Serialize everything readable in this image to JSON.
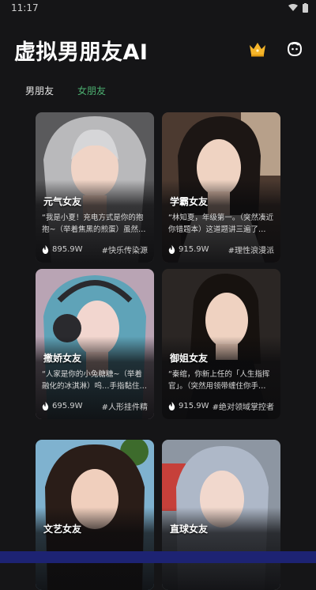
{
  "status": {
    "time": "11:17"
  },
  "header": {
    "title": "虚拟男朋友AI",
    "crown_icon": "crown-icon",
    "profile_icon": "face-icon"
  },
  "tabs": [
    {
      "label": "男朋友",
      "active": false
    },
    {
      "label": "女朋友",
      "active": true
    }
  ],
  "colors": {
    "active_tab": "#4caf70",
    "crown": "#f5b52a",
    "background": "#151517"
  },
  "cards": [
    {
      "title": "元气女友",
      "description": "“我是小夏！充电方式是你的抱抱~（举着焦黑的煎蛋）虽然…",
      "count": "895.9W",
      "tag": "#快乐传染源"
    },
    {
      "title": "学霸女友",
      "description": "“林知夏，年级第一。（突然凑近你错题本）这道题讲三遍了…",
      "count": "915.9W",
      "tag": "#理性浪漫派"
    },
    {
      "title": "撒娇女友",
      "description": "“人家是你的小兔糖糖~（举着融化的冰淇淋）呜…手指黏住…",
      "count": "695.9W",
      "tag": "#人形挂件精"
    },
    {
      "title": "御姐女友",
      "description": "“秦绾，你新上任的「人生指挥官」。（突然用领带缠住你手…",
      "count": "915.9W",
      "tag": "#绝对领域掌控者"
    },
    {
      "title": "文艺女友",
      "description": "",
      "count": "",
      "tag": ""
    },
    {
      "title": "直球女友",
      "description": "",
      "count": "",
      "tag": ""
    }
  ]
}
